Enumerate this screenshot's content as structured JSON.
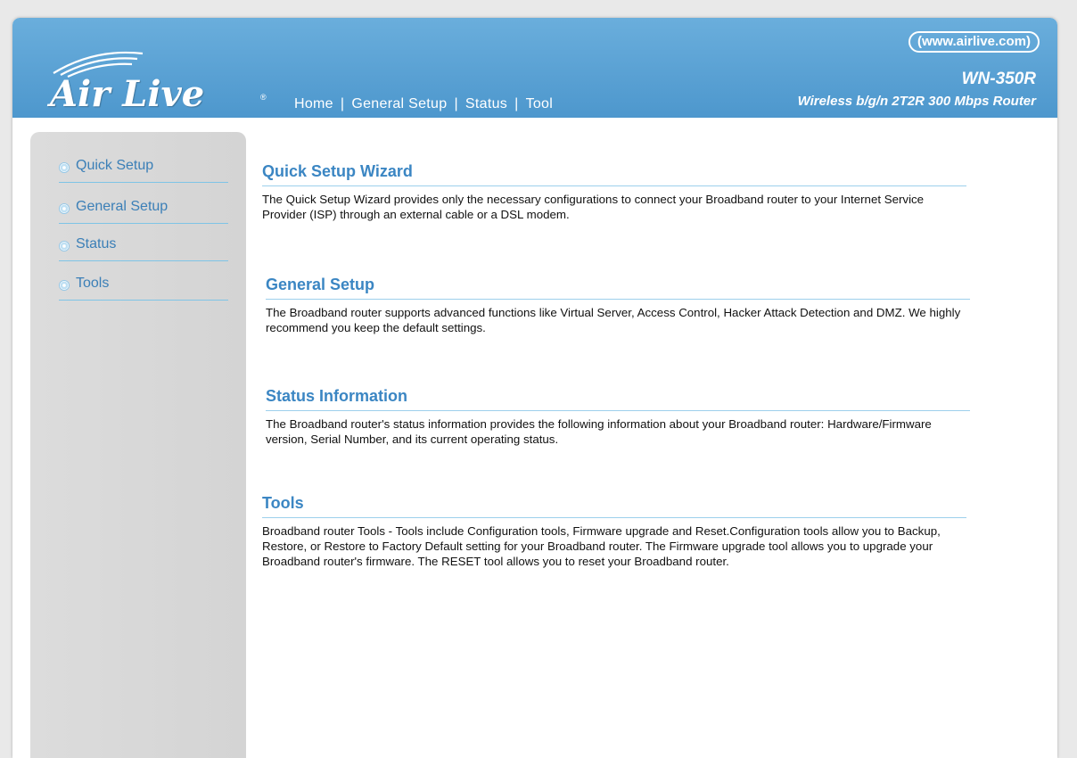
{
  "header": {
    "logo_text": "Air Live",
    "url": "(www.airlive.com)",
    "model": "WN-350R",
    "model_description": "Wireless b/g/n 2T2R 300 Mbps Router",
    "nav": [
      {
        "label": "Home"
      },
      {
        "label": "General Setup"
      },
      {
        "label": "Status"
      },
      {
        "label": "Tool"
      }
    ],
    "nav_separator": "|"
  },
  "sidebar": {
    "items": [
      {
        "label": "Quick Setup"
      },
      {
        "label": "General Setup"
      },
      {
        "label": "Status"
      },
      {
        "label": "Tools"
      }
    ]
  },
  "main": {
    "sections": [
      {
        "title": "Quick Setup Wizard",
        "text": "The Quick Setup Wizard provides only the necessary configurations to connect your Broadband router to your Internet Service Provider (ISP) through an external cable or a DSL modem."
      },
      {
        "title": "General Setup",
        "text": "The Broadband router supports advanced functions like Virtual Server, Access Control, Hacker Attack Detection and DMZ. We highly recommend you keep the default settings."
      },
      {
        "title": "Status Information",
        "text": "The Broadband router's status information provides the following information about your Broadband router: Hardware/Firmware version, Serial Number, and its current operating status."
      },
      {
        "title": "Tools",
        "text": "Broadband router Tools - Tools include Configuration tools, Firmware upgrade and Reset.Configuration tools allow you to Backup, Restore, or Restore to Factory Default setting for your Broadband router. The Firmware upgrade tool allows you to upgrade your Broadband router's firmware. The RESET tool allows you to reset your Broadband router."
      }
    ]
  },
  "colors": {
    "header_blue": "#4d97cd",
    "link_blue": "#3b7fb7",
    "heading_blue": "#3b86c3",
    "divider_blue": "#9dd0ec",
    "sidebar_gray": "#d8d8d8"
  }
}
